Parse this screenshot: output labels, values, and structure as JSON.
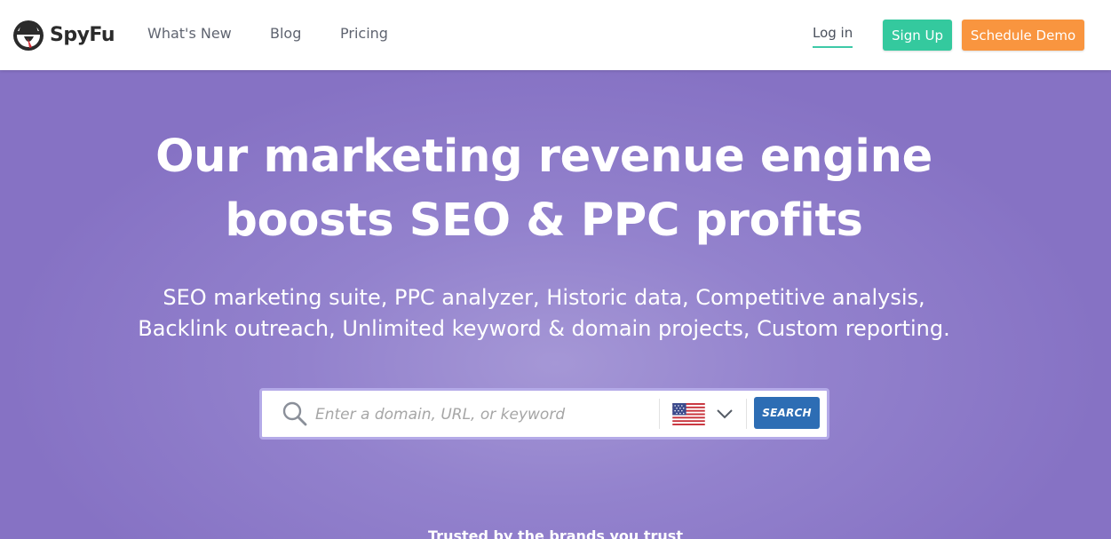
{
  "nav": {
    "logo_text": "SpyFu",
    "links": [
      "What's New",
      "Blog",
      "Pricing"
    ],
    "login": "Log in",
    "signup": "Sign Up",
    "demo": "Schedule Demo"
  },
  "hero": {
    "headline_line1": "Our marketing revenue engine",
    "headline_line2": "boosts SEO & PPC profits",
    "subline_line1": "SEO marketing suite, PPC analyzer, Historic data, Competitive analysis,",
    "subline_line2": "Backlink outreach, Unlimited keyword & domain projects, Custom reporting.",
    "trusted_text": "Trusted by the brands you trust"
  },
  "search": {
    "placeholder": "Enter a domain, URL, or keyword",
    "button": "SEARCH",
    "country_icon": "us-flag-icon"
  },
  "colors": {
    "hero_bg": "#8a78c8",
    "signup": "#34c99e",
    "demo": "#f9953f",
    "search_button": "#2d6db4",
    "login_underline": "#3ec9a7"
  }
}
